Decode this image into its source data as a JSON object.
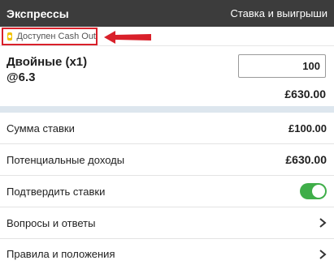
{
  "header": {
    "title": "Экспрессы",
    "right_label": "Ставка и выигрыши"
  },
  "cashout": {
    "label": "Доступен Cash Out",
    "accent": "#f2c200",
    "highlight": "#d9202a"
  },
  "bet": {
    "type": "Двойные (x1)",
    "odds": "@6.3",
    "stake_value": "100",
    "potential_return": "£630.00"
  },
  "rows": {
    "stake_label": "Сумма ставки",
    "stake_value": "£100.00",
    "income_label": "Потенциальные доходы",
    "income_value": "£630.00",
    "confirm_label": "Подтвердить ставки",
    "confirm_on": true,
    "faq_label": "Вопросы и ответы",
    "terms_label": "Правила и положения"
  },
  "colors": {
    "header_bg": "#3c3c3c",
    "toggle_on": "#3fae49",
    "separator_band": "#dde6ee"
  }
}
